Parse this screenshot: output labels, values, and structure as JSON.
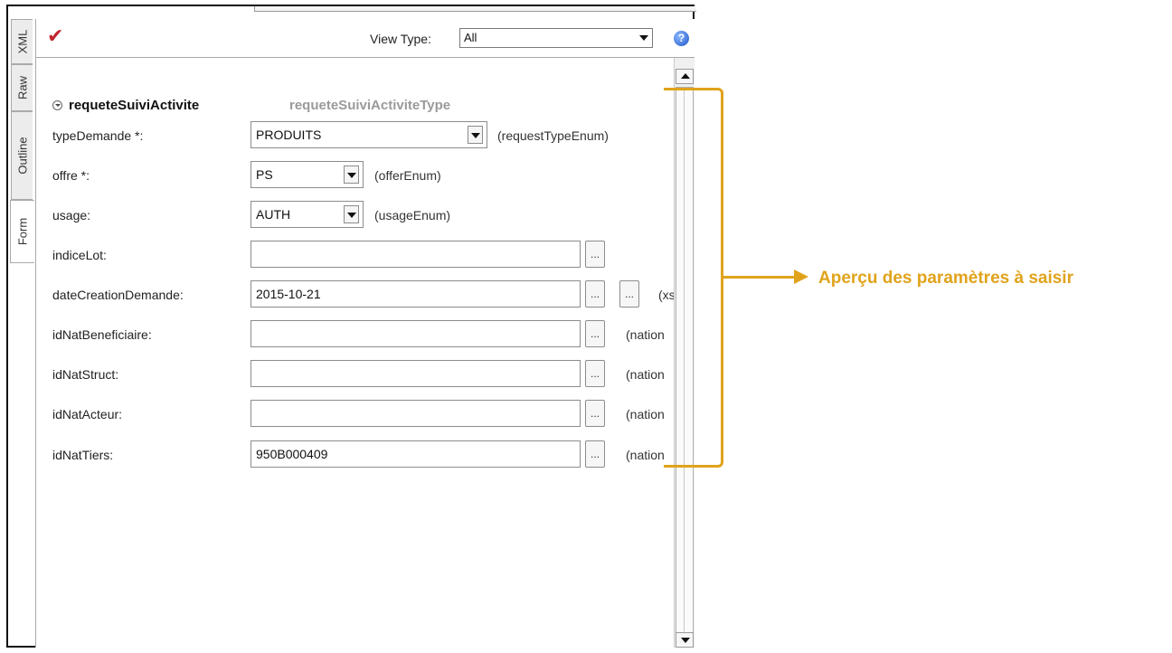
{
  "toolbar": {
    "view_type_label": "View Type:",
    "view_type_value": "All",
    "help_glyph": "?"
  },
  "side_tabs": [
    "XML",
    "Raw",
    "Outline",
    "Form"
  ],
  "section": {
    "name": "requeteSuiviActivite",
    "type": "requeteSuiviActiviteType"
  },
  "fields": [
    {
      "label": "typeDemande *:",
      "value": "PRODUITS",
      "hint": "(requestTypeEnum)"
    },
    {
      "label": "offre *:",
      "value": "PS",
      "hint": "(offerEnum)"
    },
    {
      "label": "usage:",
      "value": "AUTH",
      "hint": "(usageEnum)"
    },
    {
      "label": "indiceLot:",
      "value": "",
      "hint": ""
    },
    {
      "label": "dateCreationDemande:",
      "value": "2015-10-21",
      "hint": "(xs"
    },
    {
      "label": "idNatBeneficiaire:",
      "value": "",
      "hint": "(nation"
    },
    {
      "label": "idNatStruct:",
      "value": "",
      "hint": "(nation"
    },
    {
      "label": "idNatActeur:",
      "value": "",
      "hint": "(nation"
    },
    {
      "label": "idNatTiers:",
      "value": "950B000409",
      "hint": "(nation"
    }
  ],
  "ellipsis_glyph": "...",
  "annotation": {
    "text": "Aperçu des paramètres à saisir",
    "color": "#e0a31b"
  },
  "icons": {
    "validate": "check-icon",
    "help": "help-icon",
    "collapse": "collapse-icon"
  }
}
